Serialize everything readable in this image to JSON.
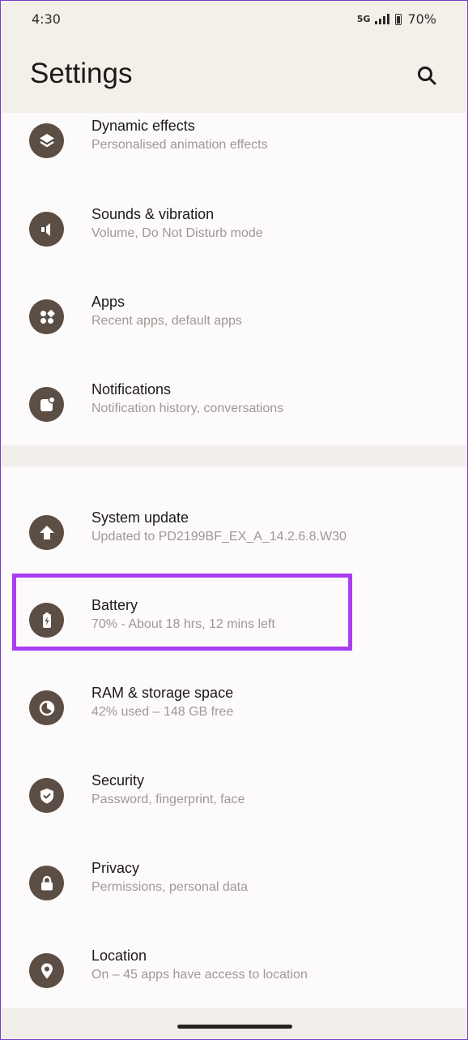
{
  "status_bar": {
    "time": "4:30",
    "network": "5G",
    "battery_percent": "70%"
  },
  "header": {
    "title": "Settings",
    "search_icon": "search-icon"
  },
  "highlight_color": "#a93df0",
  "icon_color": "#5b4e44",
  "groups": [
    {
      "items": [
        {
          "title": "Dynamic effects",
          "subtitle": "Personalised animation effects",
          "icon": "layers-icon"
        },
        {
          "title": "Sounds & vibration",
          "subtitle": "Volume, Do Not Disturb mode",
          "icon": "speaker-icon"
        },
        {
          "title": "Apps",
          "subtitle": "Recent apps, default apps",
          "icon": "apps-grid-icon"
        },
        {
          "title": "Notifications",
          "subtitle": "Notification history, conversations",
          "icon": "notification-icon"
        }
      ]
    },
    {
      "items": [
        {
          "title": "System update",
          "subtitle": "Updated to PD2199BF_EX_A_14.2.6.8.W30",
          "icon": "upload-arrow-icon"
        },
        {
          "title": "Battery",
          "subtitle": "70% - About 18 hrs, 12 mins left",
          "icon": "battery-charging-icon",
          "highlighted": true
        },
        {
          "title": "RAM & storage space",
          "subtitle": "42% used – 148 GB free",
          "icon": "pie-chart-icon"
        },
        {
          "title": "Security",
          "subtitle": "Password, fingerprint, face",
          "icon": "shield-check-icon"
        },
        {
          "title": "Privacy",
          "subtitle": "Permissions, personal data",
          "icon": "lock-icon"
        },
        {
          "title": "Location",
          "subtitle": "On – 45 apps have access to location",
          "icon": "location-pin-icon"
        }
      ]
    }
  ]
}
